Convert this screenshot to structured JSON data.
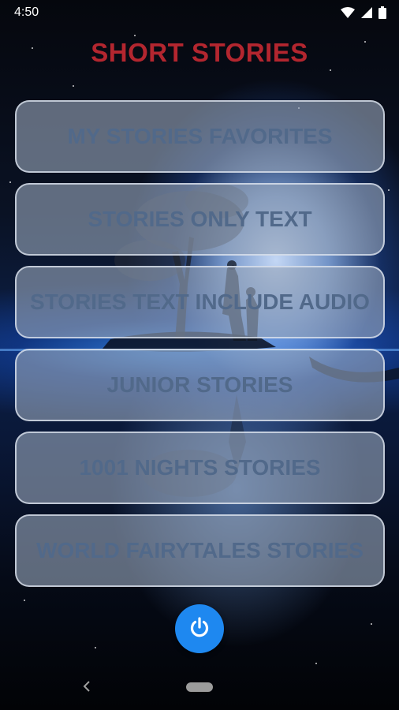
{
  "status_bar": {
    "time": "4:50",
    "icons": [
      "wifi-icon",
      "signal-icon",
      "battery-icon"
    ]
  },
  "app": {
    "title": "SHORT STORIES",
    "title_color": "#b3262f"
  },
  "menu": {
    "items": [
      {
        "label": "MY STORIES FAVORITES"
      },
      {
        "label": "STORIES ONLY TEXT"
      },
      {
        "label": "STORIES TEXT INCLUDE AUDIO"
      },
      {
        "label": "JUNIOR STORIES"
      },
      {
        "label": "1001 NIGHTS STORIES"
      },
      {
        "label": "WORLD FAIRYTALES STORIES"
      }
    ]
  },
  "power_button": {
    "icon": "power-icon",
    "color": "#1e88f0"
  },
  "nav_bar": {
    "icons": [
      "back-icon",
      "home-pill-icon"
    ]
  }
}
